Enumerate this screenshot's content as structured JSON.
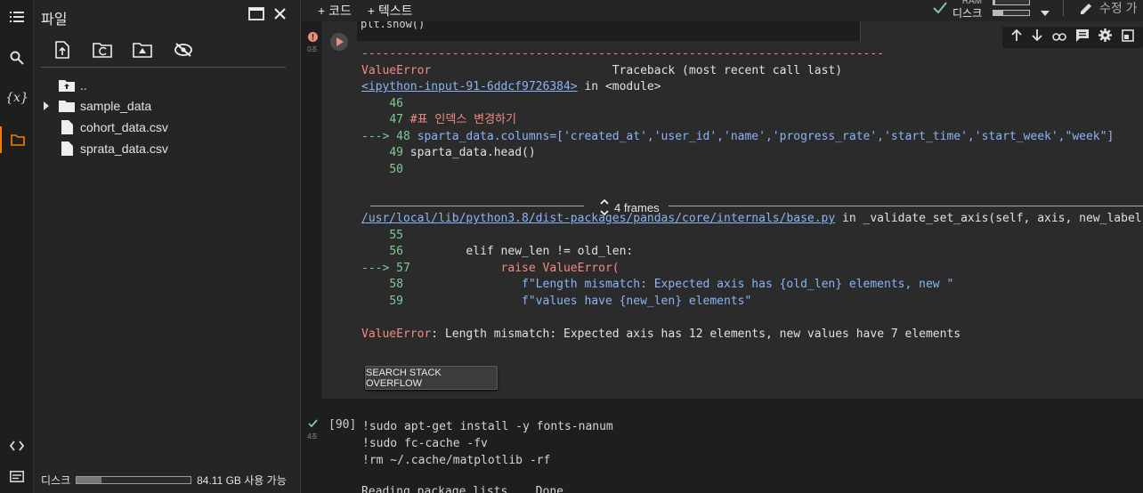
{
  "rail": {
    "items": [
      "toc-icon",
      "search-icon",
      "variables-icon",
      "files-icon"
    ],
    "bottom": [
      "code-snippets-icon",
      "command-palette-icon"
    ]
  },
  "files": {
    "title": "파일",
    "tree": [
      {
        "name": "..",
        "kind": "parent"
      },
      {
        "name": "sample_data",
        "kind": "folder"
      },
      {
        "name": "cohort_data.csv",
        "kind": "file"
      },
      {
        "name": "sprata_data.csv",
        "kind": "file"
      }
    ],
    "disk_label": "디스크",
    "disk_free": "84.11 GB 사용 가능",
    "disk_used_fraction": 0.22
  },
  "topbar": {
    "add_code": "+ 코드",
    "add_text": "+ 텍스트",
    "ram_label": "RAM",
    "disk_label": "디스크",
    "ram_fraction": 0.05,
    "disk_fraction": 0.28,
    "edit_mode": "수정 가"
  },
  "cell1": {
    "code_tail": "plt.show()",
    "exec_time": "0초",
    "output": {
      "rule": "---------------------------------------------------------------------------",
      "err_name": "ValueError",
      "traceback_label": "Traceback (most recent call last)",
      "input_link": "<ipython-input-91-6ddcf9726384>",
      "in_module": " in <module>",
      "lines1": [
        {
          "arrow": "",
          "num": "46",
          "code": ""
        },
        {
          "arrow": "",
          "num": "47",
          "code": "#표 인덱스 변경하기"
        },
        {
          "arrow": "--->",
          "num": "48",
          "code": "sparta_data.columns=['created_at','user_id','name','progress_rate','start_time','start_week',\"week\"]"
        },
        {
          "arrow": "",
          "num": "49",
          "code": "sparta_data.head()"
        },
        {
          "arrow": "",
          "num": "50",
          "code": ""
        }
      ],
      "frames_label": "4 frames",
      "file_link": "/usr/local/lib/python3.8/dist-packages/pandas/core/internals/base.py",
      "in_func": " in _validate_set_axis(self, axis, new_labels)",
      "lines2": [
        {
          "arrow": "",
          "num": "55",
          "code": ""
        },
        {
          "arrow": "",
          "num": "56",
          "code": "        elif new_len != old_len:"
        },
        {
          "arrow": "--->",
          "num": "57",
          "code": "            raise ValueError("
        },
        {
          "arrow": "",
          "num": "58",
          "code": "                f\"Length mismatch: Expected axis has {old_len} elements, new \""
        },
        {
          "arrow": "",
          "num": "59",
          "code": "                f\"values have {new_len} elements\""
        }
      ],
      "final_msg": ": Length mismatch: Expected axis has 12 elements, new values have 7 elements"
    },
    "so_button": "SEARCH STACK OVERFLOW"
  },
  "cell2": {
    "prompt": "[90]",
    "exec_time": "4초",
    "code": [
      "!sudo apt-get install -y fonts-nanum",
      "!sudo fc-cache -fv",
      "!rm ~/.cache/matplotlib -rf"
    ],
    "output_start": "Reading package lists... Done"
  }
}
